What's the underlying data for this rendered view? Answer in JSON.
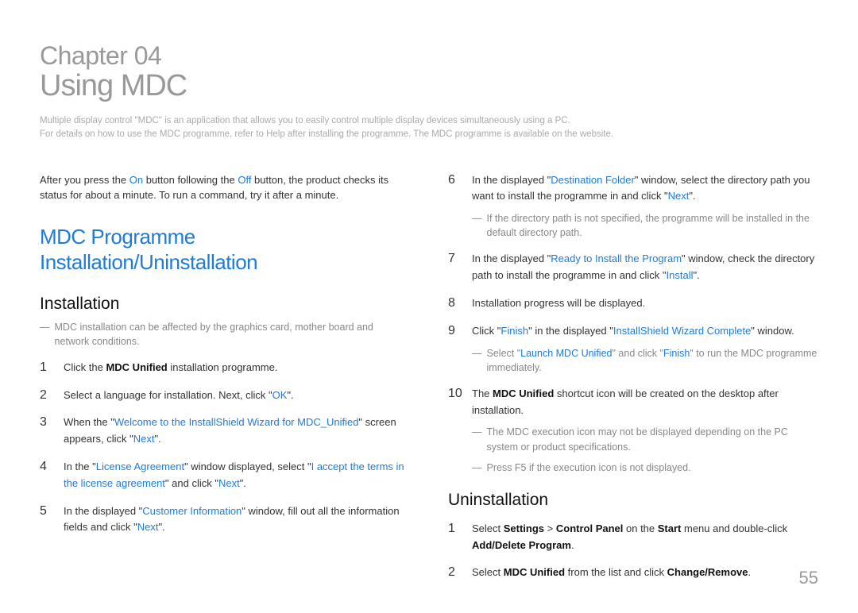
{
  "header": {
    "chapter_label": "Chapter 04",
    "chapter_title": "Using MDC",
    "intro_line1": "Multiple display control \"MDC\" is an application that allows you to easily control multiple display devices simultaneously using a PC.",
    "intro_line2": "For details on how to use the MDC programme, refer to Help after installing the programme. The MDC programme is available on the website."
  },
  "left": {
    "before_a": "After you press the ",
    "before_on": "On",
    "before_b": " button following the ",
    "before_off": "Off",
    "before_c": " button, the product checks its status for about a minute. To run a command, try it after a minute.",
    "section_title": "MDC Programme Installation/Uninstallation",
    "install_title": "Installation",
    "note_install_affect": "MDC installation can be affected by the graphics card, mother board and network conditions.",
    "s1_a": "Click the ",
    "s1_b": "MDC Unified",
    "s1_c": " installation programme.",
    "s2_a": "Select a language for installation. Next, click \"",
    "s2_ok": "OK",
    "s2_b": "\".",
    "s3_a": "When the \"",
    "s3_link": "Welcome to the InstallShield Wizard for MDC_Unified",
    "s3_b": "\" screen appears, click \"",
    "s3_next": "Next",
    "s3_c": "\".",
    "s4_a": "In the \"",
    "s4_la": "License Agreement",
    "s4_b": "\" window displayed, select \"",
    "s4_accept": "I accept the terms in the license agreement",
    "s4_c": "\" and click \"",
    "s4_next": "Next",
    "s4_d": "\".",
    "s5_a": "In the displayed \"",
    "s5_ci": "Customer Information",
    "s5_b": "\" window, fill out all the information fields and click \"",
    "s5_next": "Next",
    "s5_c": "\"."
  },
  "right": {
    "s6_a": "In the displayed \"",
    "s6_df": "Destination Folder",
    "s6_b": "\" window, select the directory path you want to install the programme in and click \"",
    "s6_next": "Next",
    "s6_c": "\".",
    "s6_note": "If the directory path is not specified, the programme will be installed in the default directory path.",
    "s7_a": "In the displayed \"",
    "s7_ready": "Ready to Install the Program",
    "s7_b": "\" window, check the directory path to install the programme in and click \"",
    "s7_install": "Install",
    "s7_c": "\".",
    "s8": "Installation progress will be displayed.",
    "s9_a": "Click \"",
    "s9_finish": "Finish",
    "s9_b": "\" in the displayed \"",
    "s9_iswc": "InstallShield Wizard Complete",
    "s9_c": "\" window.",
    "s9_note_a": "Select \"",
    "s9_note_launch": "Launch MDC Unified",
    "s9_note_b": "\" and click \"",
    "s9_note_finish": "Finish",
    "s9_note_c": "\" to run the MDC programme immediately.",
    "s10_a": "The ",
    "s10_mdc": "MDC Unified",
    "s10_b": " shortcut icon will be created on the desktop after installation.",
    "s10_note1": "The MDC execution icon may not be displayed depending on the PC system or product specifications.",
    "s10_note2": "Press F5 if the execution icon is not displayed.",
    "unin_title": "Uninstallation",
    "u1_a": "Select ",
    "u1_settings": "Settings",
    "u1_gt": " > ",
    "u1_cp": "Control Panel",
    "u1_b": " on the ",
    "u1_start": "Start",
    "u1_c": " menu and double-click ",
    "u1_add": "Add/Delete Program",
    "u1_d": ".",
    "u2_a": "Select ",
    "u2_mdc": "MDC Unified",
    "u2_b": " from the list and click ",
    "u2_change": "Change/Remove",
    "u2_c": "."
  },
  "page_number": "55"
}
